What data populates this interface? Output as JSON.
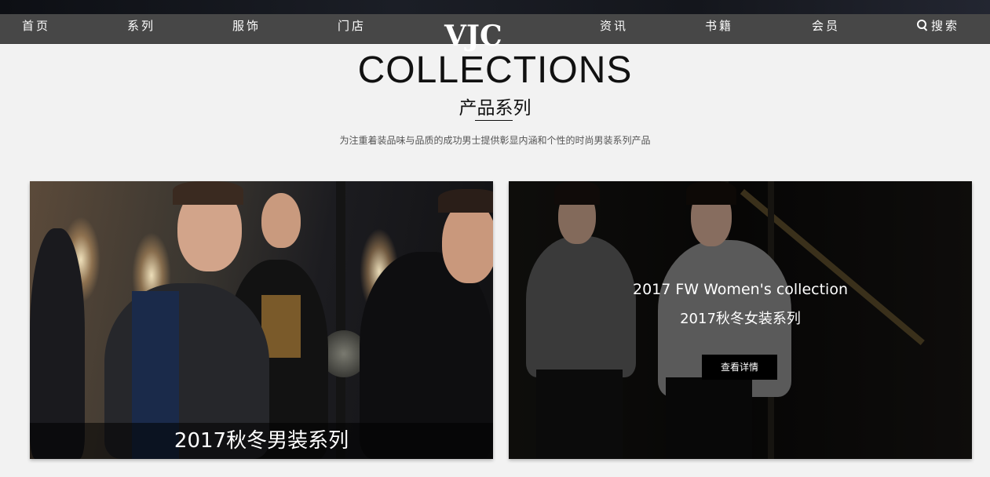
{
  "nav": {
    "items": [
      {
        "label": "首页"
      },
      {
        "label": "系列"
      },
      {
        "label": "服饰"
      },
      {
        "label": "门店"
      },
      {
        "label": "资讯"
      },
      {
        "label": "书籍"
      },
      {
        "label": "会员"
      }
    ],
    "logo": "VJC",
    "search_label": "搜索",
    "bg_color": "#474747"
  },
  "header": {
    "title": "COLLECTIONS",
    "subtitle_cn": "产品系列",
    "description": "为注重着装品味与品质的成功男士提供彰显内涵和个性的时尚男装系列产品"
  },
  "cards": [
    {
      "caption": "2017秋冬男装系列"
    },
    {
      "title_en": "2017 FW Women's collection",
      "title_cn": "2017秋冬女装系列",
      "button_label": "查看详情"
    }
  ]
}
